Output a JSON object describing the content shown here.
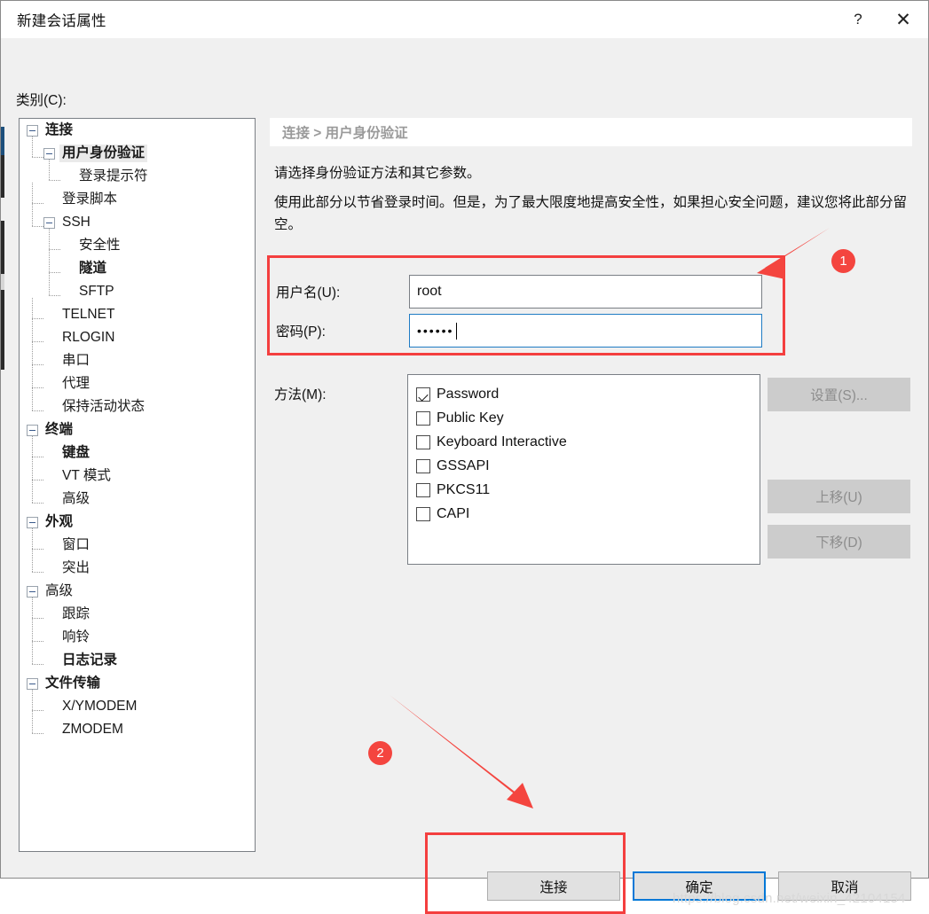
{
  "window": {
    "title": "新建会话属性",
    "help_icon": "?",
    "close_icon": "✕",
    "bg_color": "#f0f0f0",
    "accent_color": "#0078d7",
    "annotation_color": "#f4453f"
  },
  "category": {
    "label": "类别(C):",
    "tree": [
      {
        "label": "连接",
        "depth": 0,
        "toggle": "minus",
        "bold": true,
        "selected": false
      },
      {
        "label": "用户身份验证",
        "depth": 1,
        "toggle": "minus",
        "bold": true,
        "selected": true
      },
      {
        "label": "登录提示符",
        "depth": 2,
        "toggle": "none",
        "bold": false,
        "selected": false
      },
      {
        "label": "登录脚本",
        "depth": 1,
        "toggle": "none",
        "bold": false,
        "selected": false
      },
      {
        "label": "SSH",
        "depth": 1,
        "toggle": "minus",
        "bold": false,
        "selected": false
      },
      {
        "label": "安全性",
        "depth": 2,
        "toggle": "none",
        "bold": false,
        "selected": false
      },
      {
        "label": "隧道",
        "depth": 2,
        "toggle": "none",
        "bold": true,
        "selected": false
      },
      {
        "label": "SFTP",
        "depth": 2,
        "toggle": "none",
        "bold": false,
        "selected": false
      },
      {
        "label": "TELNET",
        "depth": 1,
        "toggle": "none",
        "bold": false,
        "selected": false
      },
      {
        "label": "RLOGIN",
        "depth": 1,
        "toggle": "none",
        "bold": false,
        "selected": false
      },
      {
        "label": "串口",
        "depth": 1,
        "toggle": "none",
        "bold": false,
        "selected": false
      },
      {
        "label": "代理",
        "depth": 1,
        "toggle": "none",
        "bold": false,
        "selected": false
      },
      {
        "label": "保持活动状态",
        "depth": 1,
        "toggle": "none",
        "bold": false,
        "selected": false
      },
      {
        "label": "终端",
        "depth": 0,
        "toggle": "minus",
        "bold": true,
        "selected": false
      },
      {
        "label": "键盘",
        "depth": 1,
        "toggle": "none",
        "bold": true,
        "selected": false
      },
      {
        "label": "VT 模式",
        "depth": 1,
        "toggle": "none",
        "bold": false,
        "selected": false
      },
      {
        "label": "高级",
        "depth": 1,
        "toggle": "none",
        "bold": false,
        "selected": false
      },
      {
        "label": "外观",
        "depth": 0,
        "toggle": "minus",
        "bold": true,
        "selected": false
      },
      {
        "label": "窗口",
        "depth": 1,
        "toggle": "none",
        "bold": false,
        "selected": false
      },
      {
        "label": "突出",
        "depth": 1,
        "toggle": "none",
        "bold": false,
        "selected": false
      },
      {
        "label": "高级",
        "depth": 0,
        "toggle": "minus",
        "bold": false,
        "selected": false
      },
      {
        "label": "跟踪",
        "depth": 1,
        "toggle": "none",
        "bold": false,
        "selected": false
      },
      {
        "label": "响铃",
        "depth": 1,
        "toggle": "none",
        "bold": false,
        "selected": false
      },
      {
        "label": "日志记录",
        "depth": 1,
        "toggle": "none",
        "bold": true,
        "selected": false
      },
      {
        "label": "文件传输",
        "depth": 0,
        "toggle": "minus",
        "bold": true,
        "selected": false
      },
      {
        "label": "X/YMODEM",
        "depth": 1,
        "toggle": "none",
        "bold": false,
        "selected": false
      },
      {
        "label": "ZMODEM",
        "depth": 1,
        "toggle": "none",
        "bold": false,
        "selected": false
      }
    ]
  },
  "pane": {
    "breadcrumb": "连接 > 用户身份验证",
    "description_line1": "请选择身份验证方法和其它参数。",
    "description_line2": "使用此部分以节省登录时间。但是，为了最大限度地提高安全性，如果担心安全问题，建议您将此部分留空。",
    "credentials": {
      "username_label": "用户名(U):",
      "username_value": "root",
      "username_placeholder": "",
      "password_label": "密码(P):",
      "password_value": "••••••",
      "password_placeholder": "",
      "password_focused": true
    },
    "method": {
      "label": "方法(M):",
      "items": [
        {
          "label": "Password",
          "checked": true
        },
        {
          "label": "Public Key",
          "checked": false
        },
        {
          "label": "Keyboard Interactive",
          "checked": false
        },
        {
          "label": "GSSAPI",
          "checked": false
        },
        {
          "label": "PKCS11",
          "checked": false
        },
        {
          "label": "CAPI",
          "checked": false
        }
      ]
    },
    "side_buttons": {
      "settings": "设置(S)...",
      "move_up": "上移(U)",
      "move_down": "下移(D)"
    }
  },
  "footer": {
    "connect": "连接",
    "ok": "确定",
    "cancel": "取消"
  },
  "annotations": [
    {
      "number": "1"
    },
    {
      "number": "2"
    }
  ],
  "watermark": "https://blog.csdn.net/weixin_42104154"
}
